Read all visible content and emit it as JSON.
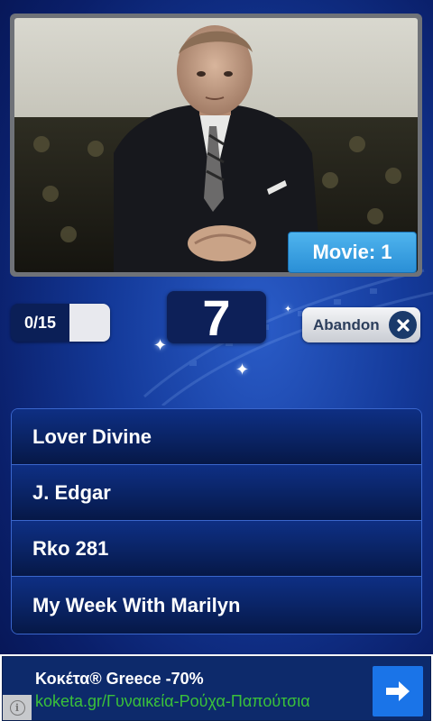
{
  "movie_badge": {
    "label": "Movie: 1"
  },
  "score": {
    "text": "0/15",
    "progress": 0
  },
  "timer": {
    "value": "7"
  },
  "abandon": {
    "label": "Abandon",
    "icon": "close-icon"
  },
  "answers": [
    {
      "label": "Lover Divine"
    },
    {
      "label": "J. Edgar"
    },
    {
      "label": "Rko 281"
    },
    {
      "label": "My Week With Marilyn"
    }
  ],
  "ad": {
    "title": "Κοκέτα® Greece -70%",
    "url": "koketa.gr/Γυναικεία-Ρούχα-Παπούτσια",
    "arrow_icon": "arrow-right-icon",
    "info_icon": "info-icon"
  },
  "colors": {
    "background": "#143a9a",
    "badge": "#3aa2e4",
    "answer": "#0a2466",
    "ad_url": "#3ac13a",
    "ad_button": "#1a74e8"
  }
}
